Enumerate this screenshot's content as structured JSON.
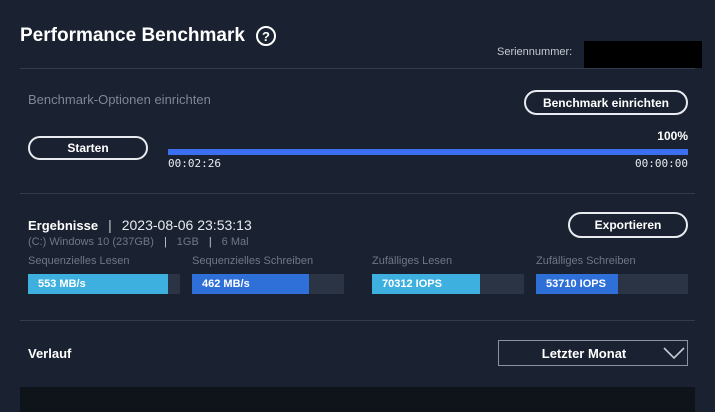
{
  "header": {
    "title": "Performance Benchmark",
    "help_icon": "?",
    "serial_label": "Seriennummer:"
  },
  "benchmark": {
    "options_label": "Benchmark-Optionen einrichten",
    "setup_button": "Benchmark einrichten",
    "start_button": "Starten",
    "progress_percent": "100%",
    "progress_fraction": 1.0,
    "elapsed": "00:02:26",
    "remaining": "00:00:00",
    "accent_color": "#3c6ef0"
  },
  "results": {
    "label": "Ergebnisse",
    "sep": "|",
    "datetime": "2023-08-06 23:53:13",
    "drive": "(C:) Windows 10 (237GB)",
    "size": "1GB",
    "runs": "6 Mal",
    "export_button": "Exportieren",
    "metrics": [
      {
        "label": "Sequenzielles Lesen",
        "value": "553 MB/s",
        "fraction": 0.92,
        "color": "#3db0e0"
      },
      {
        "label": "Sequenzielles Schreiben",
        "value": "462 MB/s",
        "fraction": 0.77,
        "color": "#2f6fd8"
      },
      {
        "label": "Zufälliges Lesen",
        "value": "70312 IOPS",
        "fraction": 0.71,
        "color": "#3db0e0"
      },
      {
        "label": "Zufälliges Schreiben",
        "value": "53710 IOPS",
        "fraction": 0.54,
        "color": "#2f6fd8"
      }
    ]
  },
  "history": {
    "label": "Verlauf",
    "range_selected": "Letzter Monat"
  }
}
